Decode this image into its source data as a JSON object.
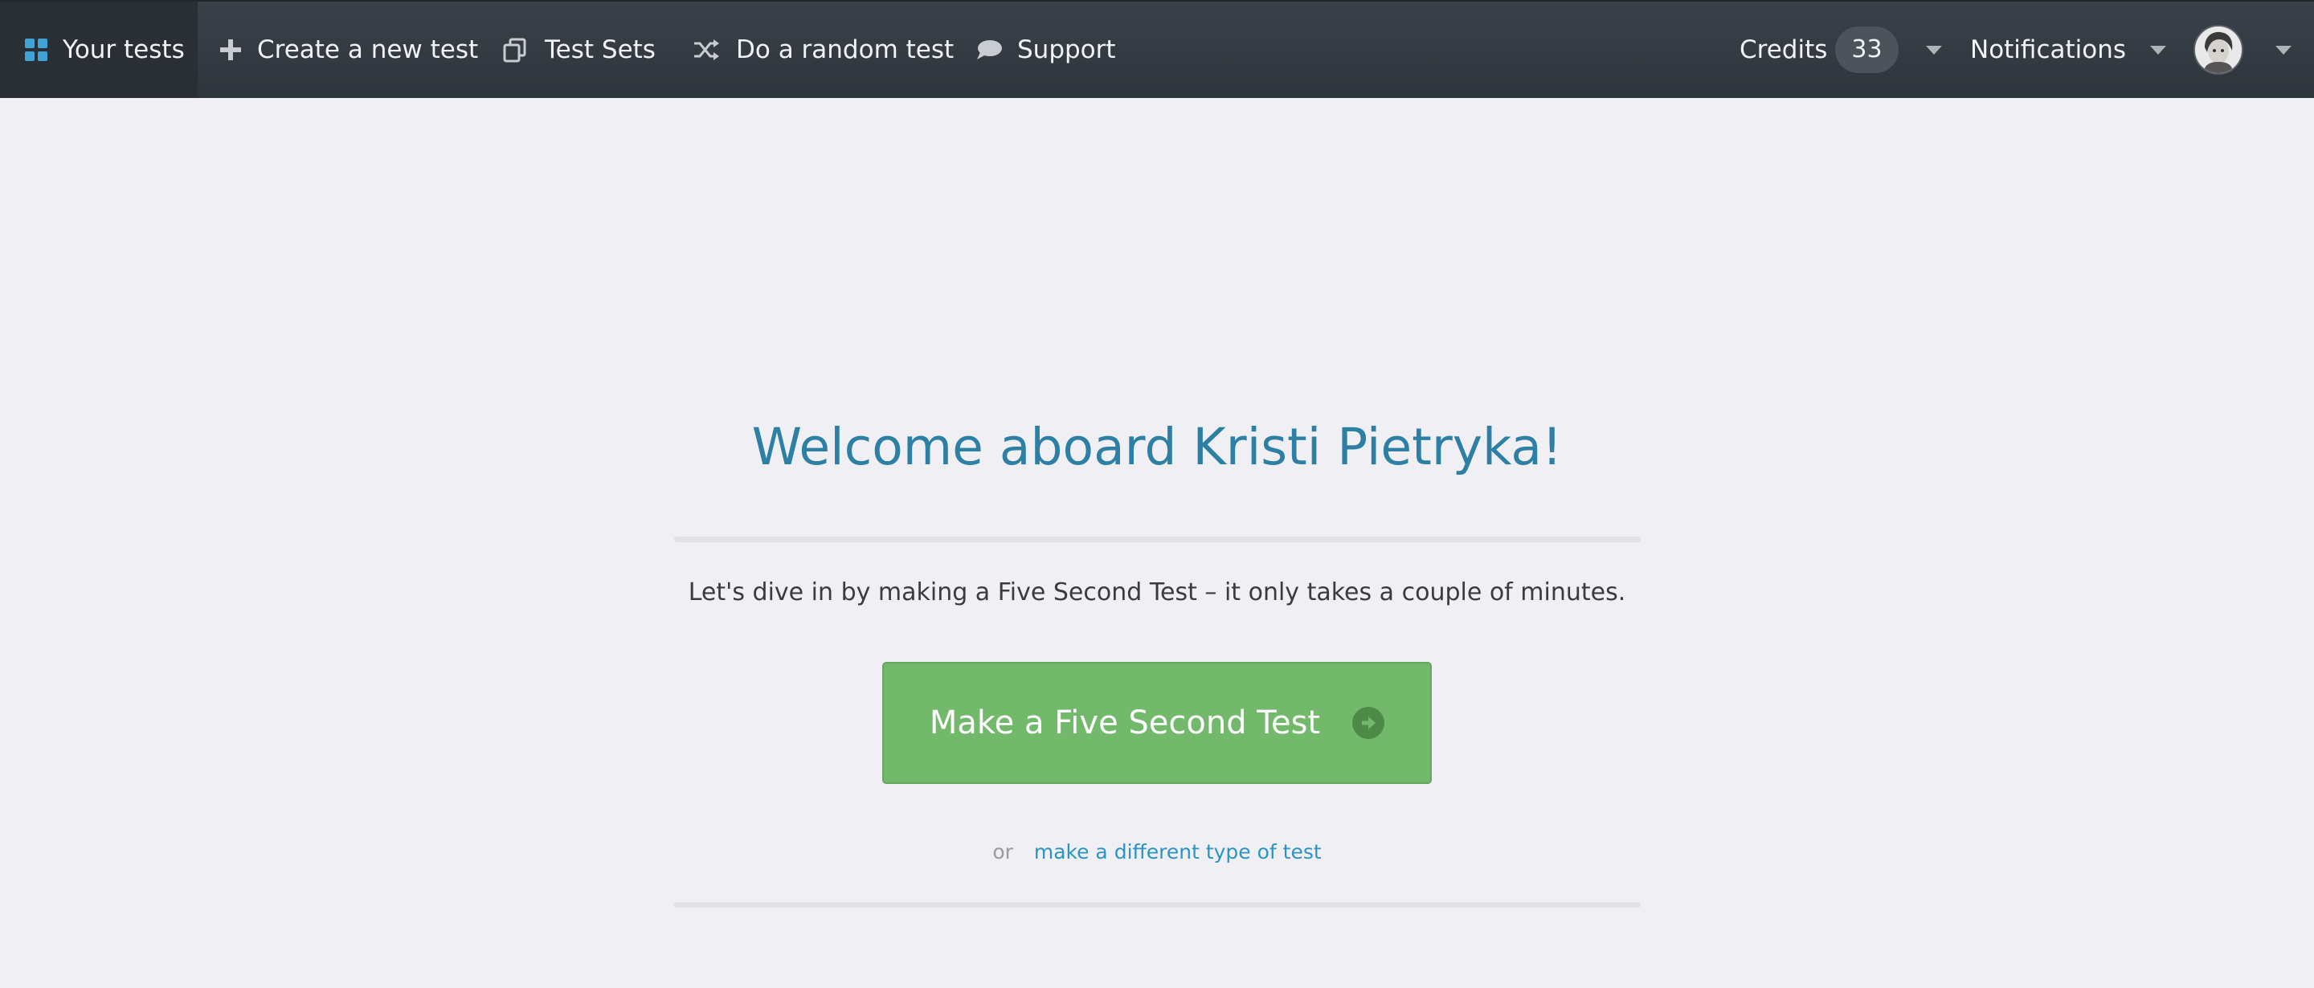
{
  "nav": {
    "your_tests": "Your tests",
    "create_new_test": "Create a new test",
    "test_sets": "Test Sets",
    "random_test": "Do a random test",
    "support": "Support",
    "credits_label": "Credits",
    "credits_count": "33",
    "notifications": "Notifications"
  },
  "icons": {
    "your_tests": "grid-icon",
    "create_new_test": "plus-icon",
    "test_sets": "copy-icon",
    "random_test": "shuffle-icon",
    "support": "speech-bubble-icon",
    "cta": "arrow-right-circle-icon"
  },
  "colors": {
    "nav_background": "#343a41",
    "accent_blue": "#2d7fa4",
    "cta_green": "#72b96c",
    "link_blue": "#2d93c4"
  },
  "main": {
    "welcome": "Welcome aboard Kristi Pietryka!",
    "intro": "Let's dive in by making a Five Second Test – it only takes a couple of minutes.",
    "cta_label": "Make a Five Second Test",
    "or_text": "or",
    "alt_link": "make a different type of test"
  }
}
